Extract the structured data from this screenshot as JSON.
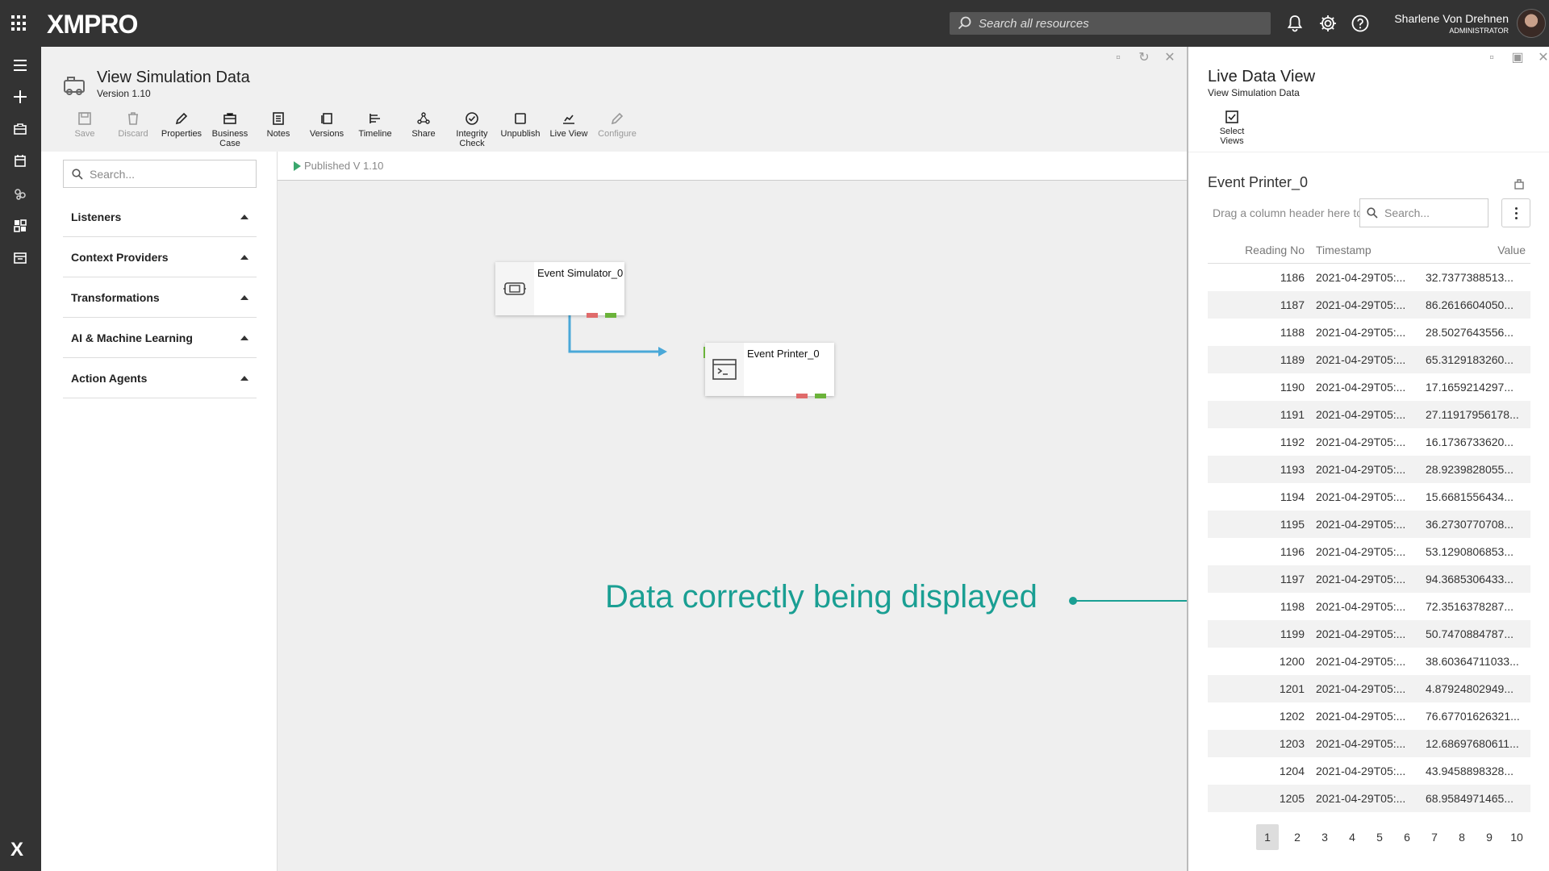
{
  "topbar": {
    "logo": "XMPRO",
    "search_placeholder": "Search all resources",
    "user_name": "Sharlene Von Drehnen",
    "user_role": "ADMINISTRATOR"
  },
  "stream": {
    "title": "View Simulation Data",
    "version": "Version 1.10",
    "published": "Published V 1.10"
  },
  "toolbar": [
    {
      "label": "Save",
      "enabled": false,
      "icon": "save-icon"
    },
    {
      "label": "Discard",
      "enabled": false,
      "icon": "trash-icon"
    },
    {
      "label": "Properties",
      "enabled": true,
      "icon": "pencil-icon"
    },
    {
      "label": "Business Case",
      "enabled": true,
      "icon": "briefcase-icon"
    },
    {
      "label": "Notes",
      "enabled": true,
      "icon": "notes-icon"
    },
    {
      "label": "Versions",
      "enabled": true,
      "icon": "versions-icon"
    },
    {
      "label": "Timeline",
      "enabled": true,
      "icon": "timeline-icon"
    },
    {
      "label": "Share",
      "enabled": true,
      "icon": "share-icon"
    },
    {
      "label": "Integrity Check",
      "enabled": true,
      "icon": "check-circle-icon"
    },
    {
      "label": "Unpublish",
      "enabled": true,
      "icon": "square-icon"
    },
    {
      "label": "Live View",
      "enabled": true,
      "icon": "live-view-icon"
    },
    {
      "label": "Configure",
      "enabled": false,
      "icon": "pencil-icon"
    }
  ],
  "library": {
    "search_placeholder": "Search...",
    "categories": [
      "Listeners",
      "Context Providers",
      "Transformations",
      "AI & Machine Learning",
      "Action Agents"
    ]
  },
  "canvas": {
    "nodes": [
      {
        "label": "Event Simulator_0",
        "icon": "simulator-icon"
      },
      {
        "label": "Event Printer_0",
        "icon": "terminal-icon"
      }
    ],
    "annotation": "Data correctly being displayed"
  },
  "live_data": {
    "title": "Live Data View",
    "subtitle": "View Simulation Data",
    "select_views": "Select Views",
    "grid_title": "Event Printer_0",
    "group_hint": "Drag a column header here to group by that column",
    "search_placeholder": "Search...",
    "columns": [
      "Reading No",
      "Timestamp",
      "Value"
    ],
    "rows": [
      [
        "1186",
        "2021-04-29T05:...",
        "32.7377388513..."
      ],
      [
        "1187",
        "2021-04-29T05:...",
        "86.2616604050..."
      ],
      [
        "1188",
        "2021-04-29T05:...",
        "28.5027643556..."
      ],
      [
        "1189",
        "2021-04-29T05:...",
        "65.3129183260..."
      ],
      [
        "1190",
        "2021-04-29T05:...",
        "17.1659214297..."
      ],
      [
        "1191",
        "2021-04-29T05:...",
        "27.11917956178..."
      ],
      [
        "1192",
        "2021-04-29T05:...",
        "16.1736733620..."
      ],
      [
        "1193",
        "2021-04-29T05:...",
        "28.9239828055..."
      ],
      [
        "1194",
        "2021-04-29T05:...",
        "15.6681556434..."
      ],
      [
        "1195",
        "2021-04-29T05:...",
        "36.2730770708..."
      ],
      [
        "1196",
        "2021-04-29T05:...",
        "53.1290806853..."
      ],
      [
        "1197",
        "2021-04-29T05:...",
        "94.3685306433..."
      ],
      [
        "1198",
        "2021-04-29T05:...",
        "72.3516378287..."
      ],
      [
        "1199",
        "2021-04-29T05:...",
        "50.7470884787..."
      ],
      [
        "1200",
        "2021-04-29T05:...",
        "38.60364711033..."
      ],
      [
        "1201",
        "2021-04-29T05:...",
        "4.87924802949..."
      ],
      [
        "1202",
        "2021-04-29T05:...",
        "76.67701626321..."
      ],
      [
        "1203",
        "2021-04-29T05:...",
        "12.68697680611..."
      ],
      [
        "1204",
        "2021-04-29T05:...",
        "43.9458898328..."
      ],
      [
        "1205",
        "2021-04-29T05:...",
        "68.9584971465..."
      ]
    ],
    "pages": [
      "1",
      "2",
      "3",
      "4",
      "5",
      "6",
      "7",
      "8",
      "9",
      "10"
    ],
    "active_page": "1"
  },
  "colors": {
    "topbar": "#333333",
    "annotation": "#1a9f93",
    "port_green": "#6bb33a",
    "port_red": "#e06b6b",
    "connector": "#4aa8d8"
  }
}
